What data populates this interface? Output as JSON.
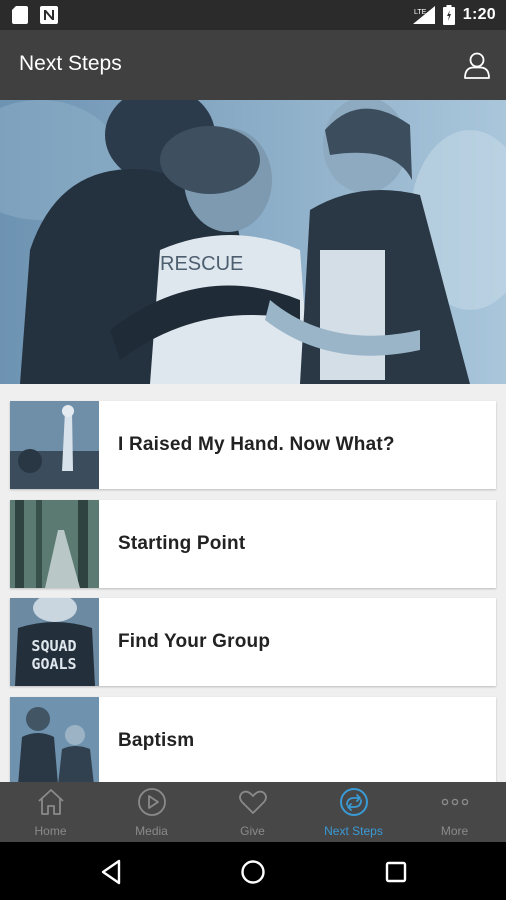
{
  "status_bar": {
    "time": "1:20",
    "network_label": "LTE",
    "icons": [
      "sd-card-icon",
      "n-notification-icon",
      "signal-icon",
      "battery-icon"
    ]
  },
  "app_bar": {
    "title": "Next Steps",
    "profile_icon": "person-outline-icon"
  },
  "hero": {
    "image": "three people embracing after baptism, blue tint",
    "shirt_text": "RESCUE"
  },
  "steps": [
    {
      "label": "I Raised My Hand. Now What?",
      "thumb": "raised-hand-thumbnail"
    },
    {
      "label": "Starting Point",
      "thumb": "forest-road-thumbnail"
    },
    {
      "label": "Find Your Group",
      "thumb": "squad-goals-thumbnail",
      "thumb_text_1": "SQUAD",
      "thumb_text_2": "GOALS"
    },
    {
      "label": "Baptism",
      "thumb": "baptism-thumbnail"
    }
  ],
  "tabs": [
    {
      "label": "Home",
      "icon": "home-icon",
      "active": false
    },
    {
      "label": "Media",
      "icon": "play-circle-icon",
      "active": false
    },
    {
      "label": "Give",
      "icon": "heart-icon",
      "active": false
    },
    {
      "label": "Next Steps",
      "icon": "next-steps-circle-icon",
      "active": true
    },
    {
      "label": "More",
      "icon": "more-dots-icon",
      "active": false
    }
  ],
  "colors": {
    "status_bar": "#2b2b2b",
    "app_bar": "#404040",
    "tab_bar": "#474747",
    "tab_inactive": "#8a8a8a",
    "tab_active": "#3a9ad6",
    "list_background": "#efefef"
  }
}
